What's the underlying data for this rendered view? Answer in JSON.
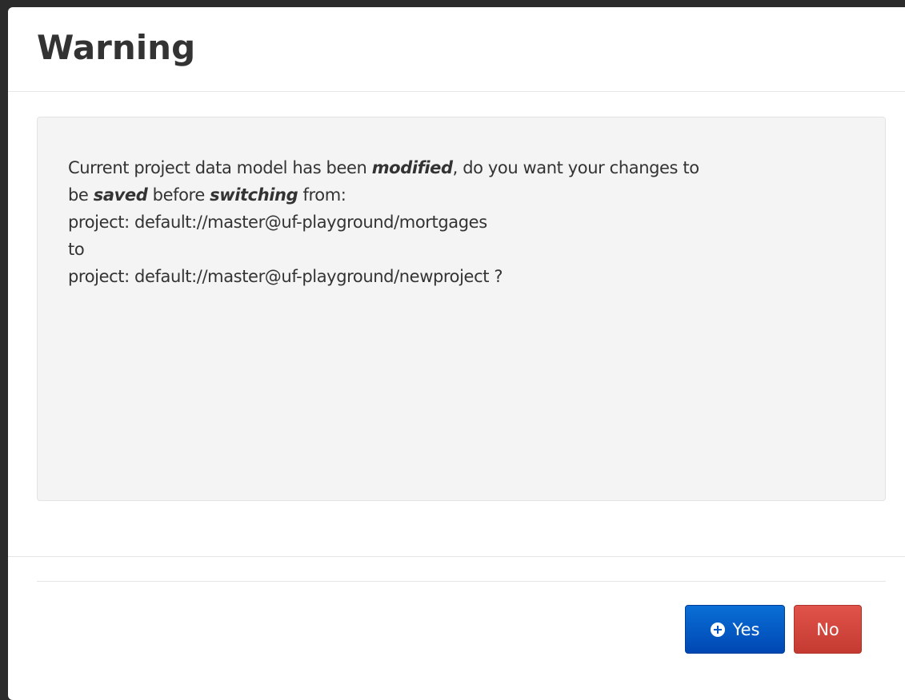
{
  "dialog": {
    "title": "Warning",
    "message": {
      "line1_prefix": "Current project data model has been ",
      "line1_em": "modified",
      "line1_suffix": ", do you want your changes to",
      "line2_prefix": "be ",
      "line2_em1": "saved",
      "line2_mid": " before ",
      "line2_em2": "switching",
      "line2_suffix": " from:",
      "from_project": "project: default://master@uf-playground/mortgages",
      "to_label": "to",
      "to_project": "project: default://master@uf-playground/newproject ?"
    },
    "buttons": {
      "yes_label": "Yes",
      "no_label": "No"
    }
  },
  "colors": {
    "yes_button": "#0055c4",
    "no_button": "#d2453c",
    "well_background": "#f4f4f4"
  },
  "icons": {
    "yes_icon": "plus-circle-icon"
  }
}
